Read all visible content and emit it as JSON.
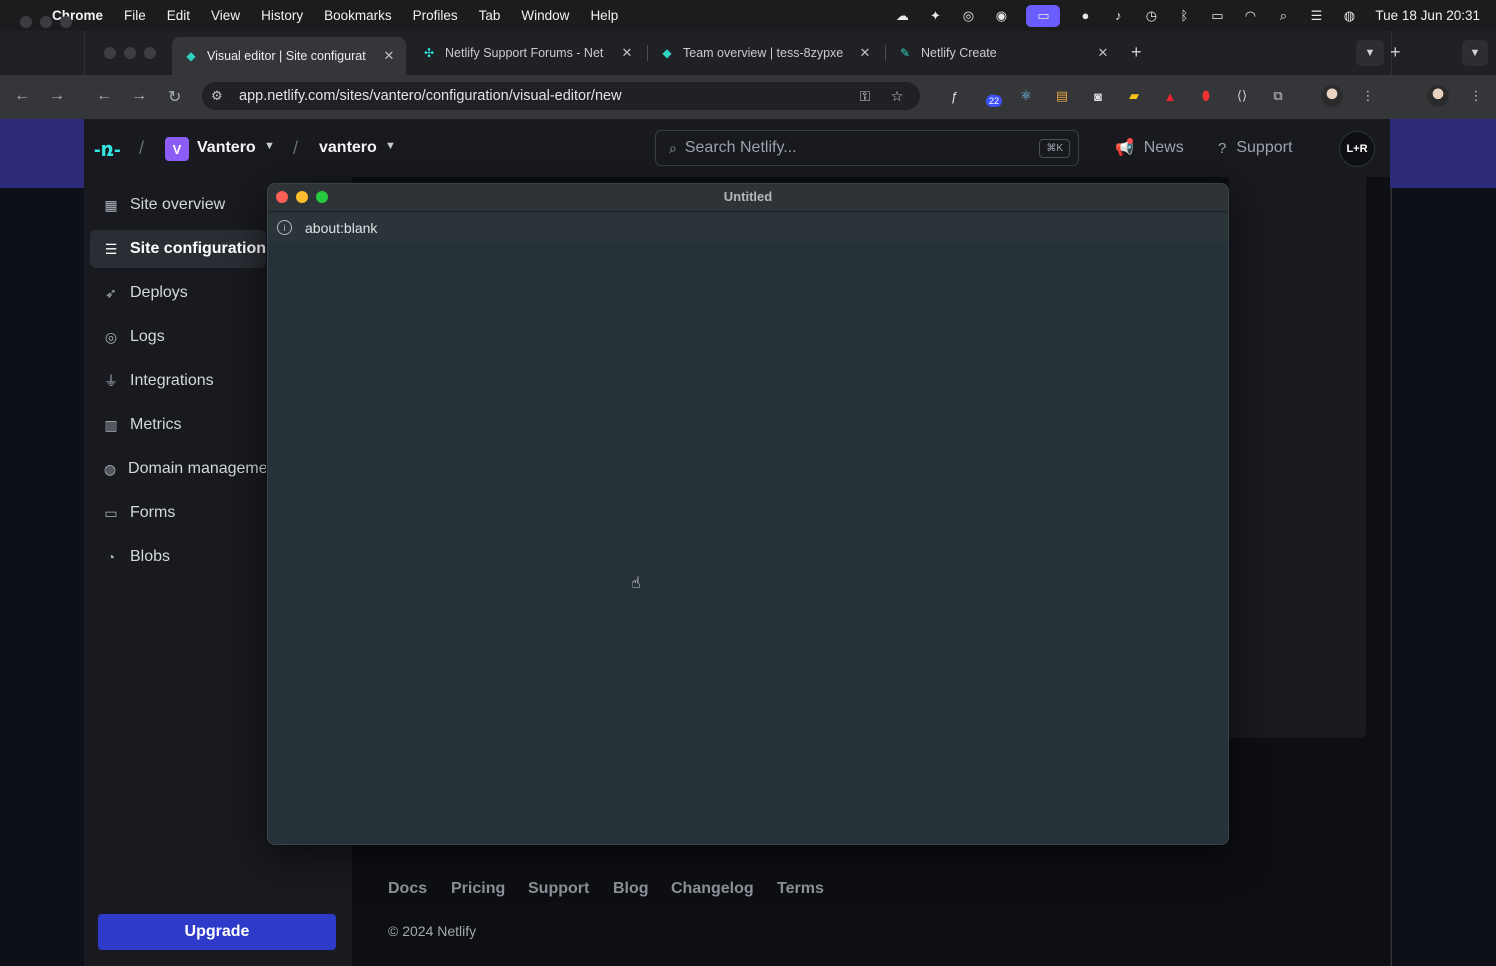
{
  "menubar": {
    "app": "Chrome",
    "items": [
      "File",
      "Edit",
      "View",
      "History",
      "Bookmarks",
      "Profiles",
      "Tab",
      "Window",
      "Help"
    ],
    "clock": "Tue 18 Jun  20:31"
  },
  "tabs": [
    {
      "title": "Visual editor | Site configurat",
      "active": true
    },
    {
      "title": "Netlify Support Forums - Net",
      "active": false
    },
    {
      "title": "Team overview | tess-8zypxe",
      "active": false
    },
    {
      "title": "Netlify Create",
      "active": false
    }
  ],
  "toolbar": {
    "url": "app.netlify.com/sites/vantero/configuration/visual-editor/new",
    "extension_badge": "22"
  },
  "header": {
    "team_initial": "V",
    "team_name": "Vantero",
    "site_name": "vantero",
    "search_placeholder": "Search Netlify...",
    "search_shortcut": "⌘K",
    "news": "News",
    "support": "Support",
    "user_initials": "L+R"
  },
  "sidebar": {
    "items": [
      {
        "label": "Site overview",
        "icon": "grid-icon"
      },
      {
        "label": "Site configuration",
        "icon": "settings-list-icon"
      },
      {
        "label": "Deploys",
        "icon": "rocket-icon"
      },
      {
        "label": "Logs",
        "icon": "logs-icon"
      },
      {
        "label": "Integrations",
        "icon": "plug-icon"
      },
      {
        "label": "Metrics",
        "icon": "bar-chart-icon"
      },
      {
        "label": "Domain management",
        "icon": "globe-icon"
      },
      {
        "label": "Forms",
        "icon": "forms-icon"
      },
      {
        "label": "Blobs",
        "icon": "blobs-icon"
      }
    ],
    "upgrade": "Upgrade"
  },
  "footer": {
    "links": [
      "Docs",
      "Pricing",
      "Support",
      "Blog",
      "Changelog",
      "Terms"
    ],
    "copyright": "© 2024 Netlify"
  },
  "popup": {
    "title": "Untitled",
    "url": "about:blank"
  },
  "colors": {
    "netlify_teal": "#32e6e2",
    "upgrade_blue": "#2e3bc9",
    "team_purple": "#8b5cf6",
    "popup_bg": "#263238"
  }
}
